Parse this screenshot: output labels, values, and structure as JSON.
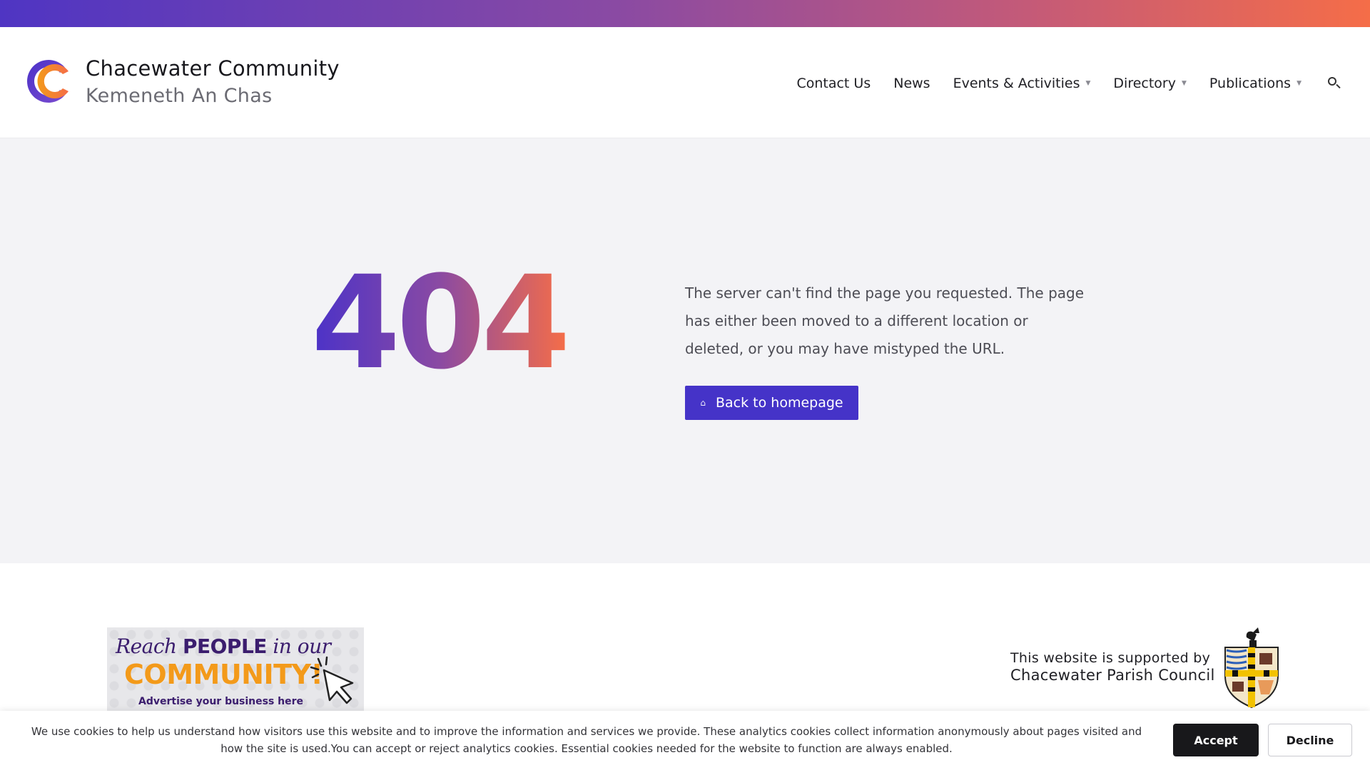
{
  "colors": {
    "top_strip_start": "#4f35c3",
    "top_strip_end": "#f56d48",
    "primary_button": "#4533c8",
    "hero_background": "#f3f3f6",
    "accept_button": "#18181b"
  },
  "header": {
    "site_title": "Chacewater Community",
    "site_subtitle": "Kemeneth An Chas",
    "logo_icon": "c-monogram-logo"
  },
  "nav": {
    "items": [
      {
        "label": "Contact Us",
        "has_dropdown": false
      },
      {
        "label": "News",
        "has_dropdown": false
      },
      {
        "label": "Events & Activities",
        "has_dropdown": true
      },
      {
        "label": "Directory",
        "has_dropdown": true
      },
      {
        "label": "Publications",
        "has_dropdown": true
      }
    ],
    "search_icon": "search-icon"
  },
  "hero": {
    "code": "404",
    "message": "The server can't find the page you requested. The page has either been moved to a different location or deleted, or you may have mistyped the URL.",
    "button_label": "Back to homepage",
    "button_icon": "home-icon"
  },
  "footer": {
    "ad": {
      "line1_italic_a": "Reach ",
      "line1_bold": "PEOPLE",
      "line1_italic_b": " in our",
      "line2": "COMMUNITY!",
      "line3": "Advertise your business here"
    },
    "support": {
      "line1": "This website is supported by",
      "line2": "Chacewater Parish Council",
      "crest_icon": "parish-crest-icon"
    }
  },
  "cookie_bar": {
    "text": "We use cookies to help us understand how visitors use this website and to improve the information and services we provide. These analytics cookies collect information anonymously about pages visited and how the site is used.You can accept or reject analytics cookies. Essential cookies needed for the website to function are always enabled.",
    "accept_label": "Accept",
    "decline_label": "Decline"
  }
}
